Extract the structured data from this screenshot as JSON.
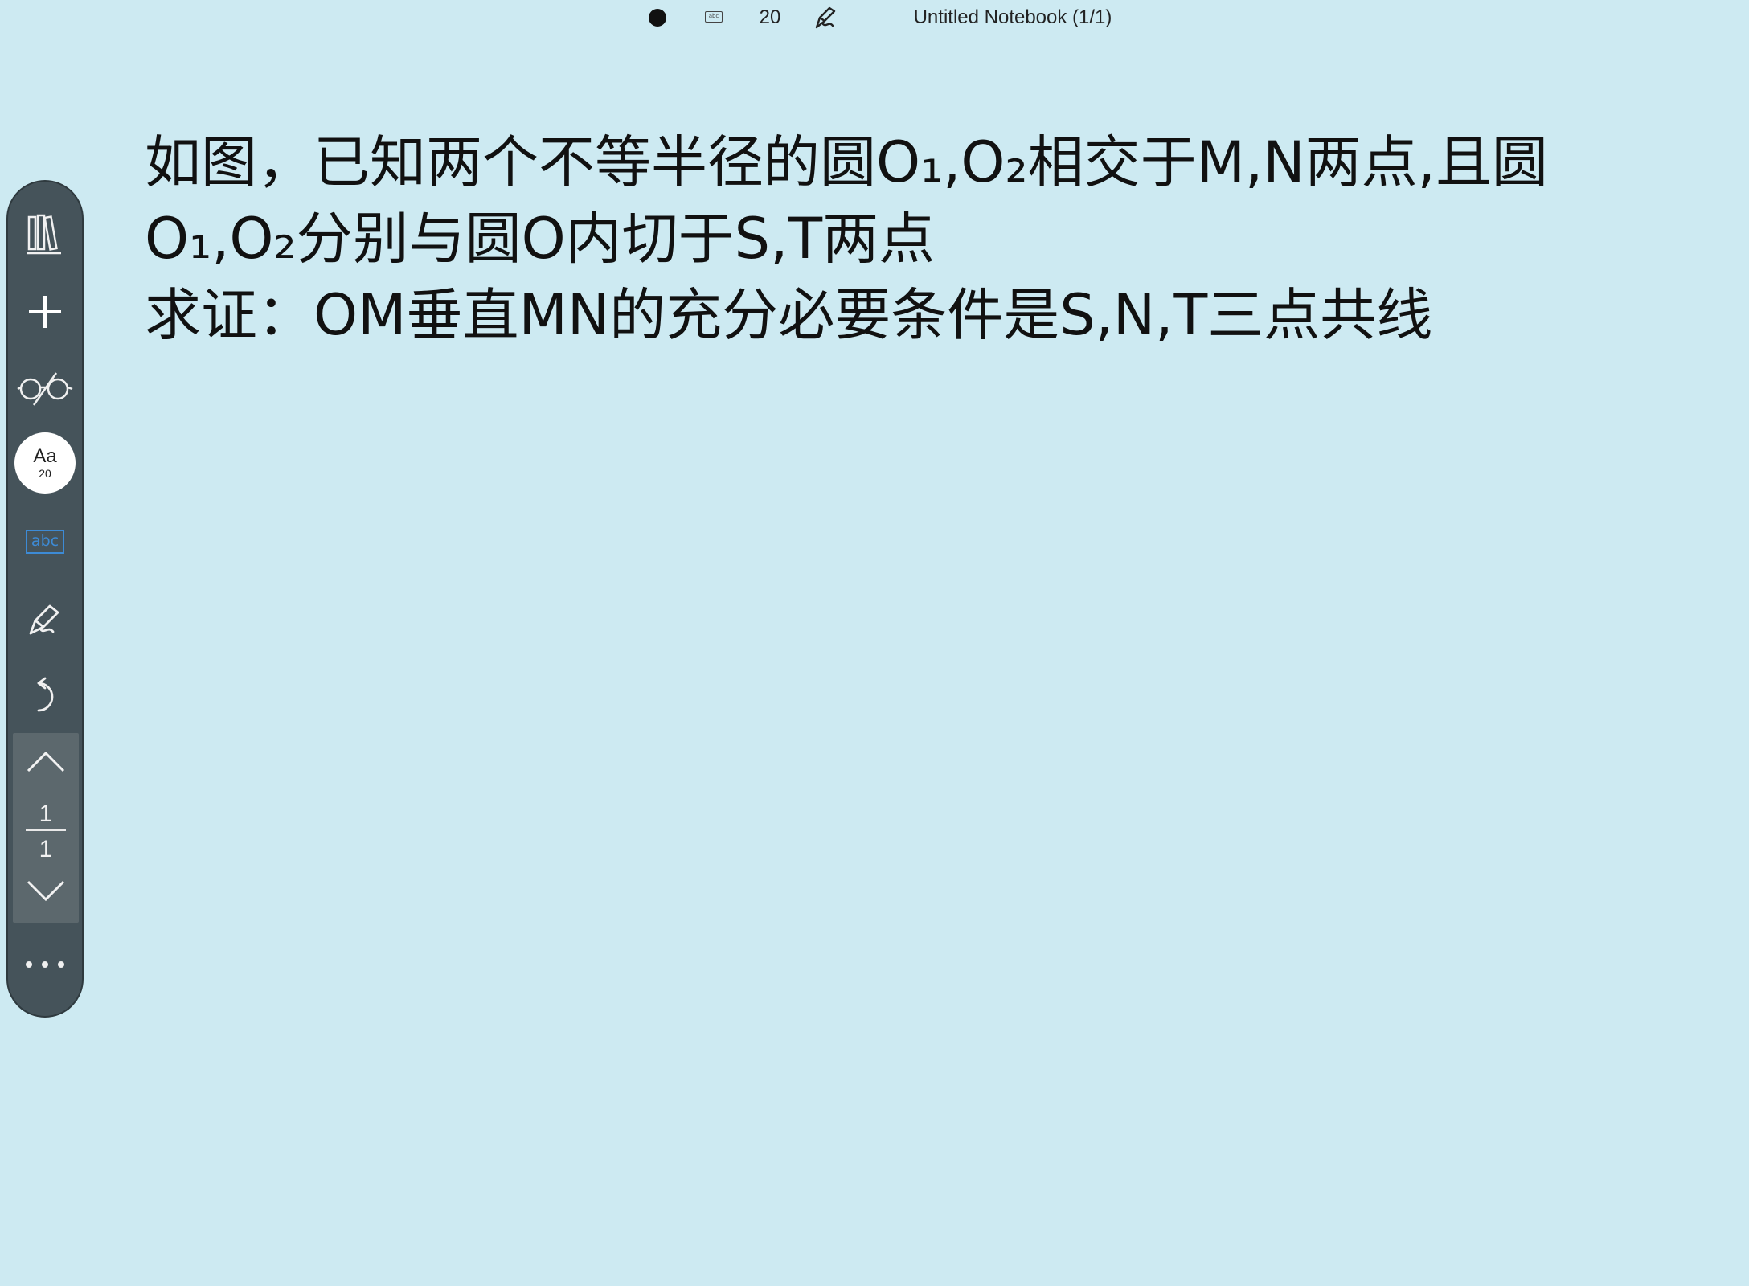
{
  "topbar": {
    "dot_icon": "filled-circle-icon",
    "keyboard_icon": "keyboard-abc-icon",
    "keyboard_label": "abc",
    "font_size": "20",
    "pen_icon": "pen-icon",
    "title": "Untitled Notebook (1/1)"
  },
  "toolbar": {
    "library_icon": "library-books-icon",
    "add_icon": "plus-icon",
    "view_icon": "glasses-icon",
    "font_label": "Aa",
    "font_size": "20",
    "text_mode_label": "abc",
    "pen_icon": "pen-icon",
    "undo_icon": "undo-icon",
    "pager": {
      "current": "1",
      "total": "1",
      "up_icon": "chevron-up-icon",
      "down_icon": "chevron-down-icon"
    },
    "more_icon": "more-dots-icon"
  },
  "page": {
    "lines": [
      "如图，已知两个不等半径的圆O₁,O₂相交于M,N两点,且圆",
      "O₁,O₂分别与圆O内切于S,T两点",
      "求证：OM垂直MN的充分必要条件是S,N,T三点共线"
    ]
  },
  "colors": {
    "background": "#cdeaf2",
    "toolbar": "#45535a",
    "accent": "#3d8bd6"
  }
}
